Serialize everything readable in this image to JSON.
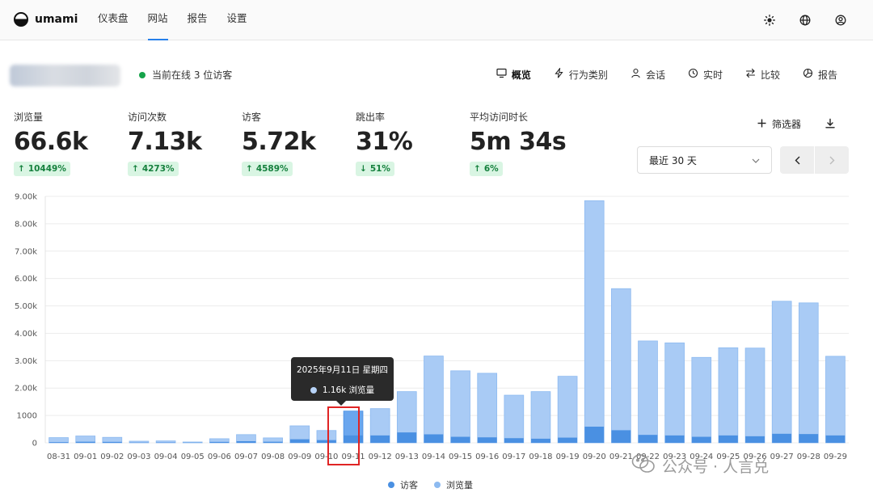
{
  "app": {
    "brand": "umami",
    "nav": [
      {
        "label": "仪表盘",
        "active": false
      },
      {
        "label": "网站",
        "active": true
      },
      {
        "label": "报告",
        "active": false
      },
      {
        "label": "设置",
        "active": false
      }
    ],
    "icons": [
      "sun-icon",
      "globe-icon",
      "user-icon"
    ]
  },
  "site": {
    "online_text": "当前在线 3 位访客",
    "tabs": [
      {
        "label": "概览",
        "icon": "monitor-icon",
        "active": true
      },
      {
        "label": "行为类别",
        "icon": "lightning-icon",
        "active": false
      },
      {
        "label": "会话",
        "icon": "user-icon",
        "active": false
      },
      {
        "label": "实时",
        "icon": "clock-icon",
        "active": false
      },
      {
        "label": "比较",
        "icon": "swap-icon",
        "active": false
      },
      {
        "label": "报告",
        "icon": "pie-icon",
        "active": false
      }
    ]
  },
  "metrics": [
    {
      "label": "浏览量",
      "value": "66.6k",
      "change": "10449%",
      "direction": "up"
    },
    {
      "label": "访问次数",
      "value": "7.13k",
      "change": "4273%",
      "direction": "up"
    },
    {
      "label": "访客",
      "value": "5.72k",
      "change": "4589%",
      "direction": "up"
    },
    {
      "label": "跳出率",
      "value": "31%",
      "change": "51%",
      "direction": "down"
    },
    {
      "label": "平均访问时长",
      "value": "5m 34s",
      "change": "6%",
      "direction": "up"
    }
  ],
  "controls": {
    "filter_label": "筛选器",
    "date_range": "最近 30 天"
  },
  "colors": {
    "visitors": "#4a90e2",
    "views": "#a9cbf5",
    "views_border": "#8dbaf0",
    "highlight": "#e02424",
    "accent": "#2680eb",
    "change_bg": "#d9f5e3",
    "change_text": "#15803d"
  },
  "chart_data": {
    "type": "bar",
    "stacked": "overlay",
    "categories": [
      "08-31",
      "09-01",
      "09-02",
      "09-03",
      "09-04",
      "09-05",
      "09-06",
      "09-07",
      "09-08",
      "09-09",
      "09-10",
      "09-11",
      "09-12",
      "09-13",
      "09-14",
      "09-15",
      "09-16",
      "09-17",
      "09-18",
      "09-19",
      "09-20",
      "09-21",
      "09-22",
      "09-23",
      "09-24",
      "09-25",
      "09-26",
      "09-27",
      "09-28",
      "09-29"
    ],
    "series": [
      {
        "name": "访客",
        "values": [
          25,
          40,
          35,
          12,
          15,
          8,
          35,
          60,
          40,
          130,
          100,
          270,
          270,
          380,
          310,
          220,
          200,
          170,
          150,
          190,
          590,
          460,
          290,
          270,
          220,
          270,
          240,
          330,
          320,
          270
        ]
      },
      {
        "name": "浏览量",
        "values": [
          190,
          250,
          200,
          60,
          70,
          30,
          150,
          300,
          180,
          620,
          450,
          1160,
          1250,
          1870,
          3170,
          2630,
          2540,
          1740,
          1870,
          2430,
          8840,
          5630,
          3720,
          3650,
          3120,
          3470,
          3460,
          5170,
          5110,
          3160
        ]
      }
    ],
    "y_ticks": [
      "0",
      "1000",
      "2.00k",
      "3.00k",
      "4.00k",
      "5.00k",
      "6.00k",
      "7.00k",
      "8.00k",
      "9.00k"
    ],
    "ylim": [
      0,
      9000
    ],
    "grid": true,
    "legend": "bottom-center",
    "tooltip": {
      "category_index": 11,
      "title": "2025年9月11日 星期四",
      "row": "1.16k 浏览量"
    }
  },
  "watermark": {
    "text": "公众号 · 人言兑",
    "icon": "wechat-icon"
  }
}
